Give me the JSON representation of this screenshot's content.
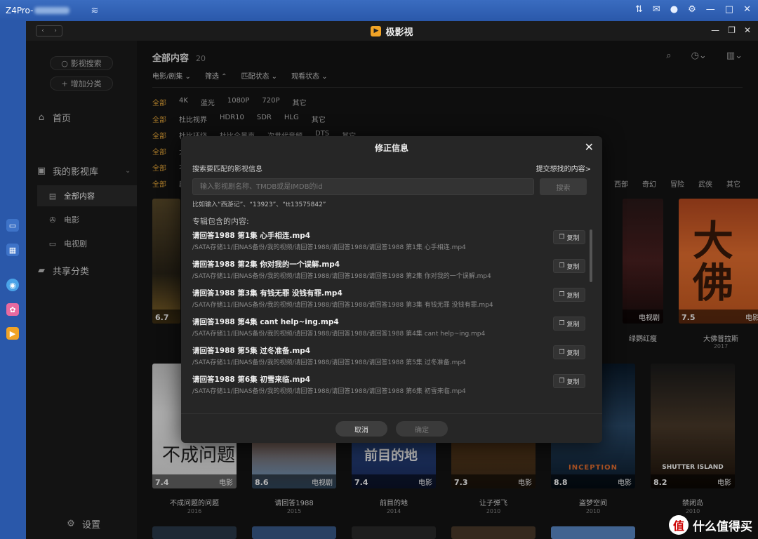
{
  "os": {
    "title": "Z4Pro-",
    "wifi_icon": "wifi-icon"
  },
  "app": {
    "title": "极影视"
  },
  "sidebar": {
    "search_btn": "影视搜索",
    "add_category_btn": "增加分类",
    "home": "首页",
    "my_library": "我的影视库",
    "sub_items": [
      "全部内容",
      "电影",
      "电视剧"
    ],
    "shared": "共享分类",
    "settings": "设置"
  },
  "main": {
    "title": "全部内容",
    "count": "20",
    "dropdowns": [
      "电影/剧集",
      "筛选",
      "匹配状态",
      "观看状态"
    ],
    "filter_rows": [
      [
        "全部",
        "4K",
        "蓝光",
        "1080P",
        "720P",
        "其它"
      ],
      [
        "全部",
        "杜比视界",
        "HDR10",
        "SDR",
        "HLG",
        "其它"
      ],
      [
        "全部",
        "杜比环绕",
        "杜比全景声",
        "次世代音频",
        "DTS",
        "其它"
      ],
      [
        "全部",
        "大"
      ],
      [
        "全部",
        "不"
      ],
      [
        "全部",
        "剧"
      ]
    ],
    "genre_tail": [
      "西部",
      "奇幻",
      "冒险",
      "武侠",
      "其它"
    ]
  },
  "posters_top": [
    {
      "rating": "6.7",
      "type": "",
      "title": "",
      "year": ""
    },
    {
      "rating": "",
      "type": "电视剧",
      "title": "绿鹦红瘦",
      "year": ""
    },
    {
      "rating": "7.5",
      "type": "电影",
      "title": "大佛普拉斯",
      "year": "2017"
    }
  ],
  "posters_bottom": [
    {
      "rating": "7.4",
      "type": "电影",
      "title": "不成问题的问题",
      "year": "2016"
    },
    {
      "rating": "8.6",
      "type": "电视剧",
      "title": "请回答1988",
      "year": "2015"
    },
    {
      "rating": "7.4",
      "type": "电影",
      "title": "前目的地",
      "year": "2014"
    },
    {
      "rating": "7.3",
      "type": "电影",
      "title": "让子弹飞",
      "year": "2010"
    },
    {
      "rating": "8.8",
      "type": "电影",
      "title": "盗梦空间",
      "year": "2010"
    },
    {
      "rating": "8.2",
      "type": "电影",
      "title": "禁闭岛",
      "year": "2010"
    }
  ],
  "poster_art": {
    "p1_text": "前目的地",
    "p2_text": "INCEPTION",
    "p3_text": "SHUTTER ISLAND"
  },
  "modal": {
    "title": "修正信息",
    "label": "搜索要匹配的影视信息",
    "link": "提交想找的内容>",
    "input_placeholder": "输入影视剧名称、TMDB或是IMDB的id",
    "search_btn": "搜索",
    "example": "比如输入“西游记”、“13923”、“tt13575842”",
    "section": "专辑包含的内容:",
    "copy_label": "复制",
    "files": [
      {
        "name": "请回答1988 第1集 心手相连.mp4",
        "path": "/SATA存储11/旧NAS备份/我的视频/请回答1988/请回答1988/请回答1988 第1集 心手相连.mp4"
      },
      {
        "name": "请回答1988 第2集 你对我的一个误解.mp4",
        "path": "/SATA存储11/旧NAS备份/我的视频/请回答1988/请回答1988/请回答1988 第2集 你对我的一个误解.mp4"
      },
      {
        "name": "请回答1988 第3集 有钱无罪 没钱有罪.mp4",
        "path": "/SATA存储11/旧NAS备份/我的视频/请回答1988/请回答1988/请回答1988 第3集 有钱无罪 没钱有罪.mp4"
      },
      {
        "name": "请回答1988 第4集 cant help~ing.mp4",
        "path": "/SATA存储11/旧NAS备份/我的视频/请回答1988/请回答1988/请回答1988 第4集 cant help~ing.mp4"
      },
      {
        "name": "请回答1988 第5集 过冬准备.mp4",
        "path": "/SATA存储11/旧NAS备份/我的视频/请回答1988/请回答1988/请回答1988 第5集 过冬准备.mp4"
      },
      {
        "name": "请回答1988 第6集 初雪来临.mp4",
        "path": "/SATA存储11/旧NAS备份/我的视频/请回答1988/请回答1988/请回答1988 第6集 初雪来临.mp4"
      }
    ],
    "cancel": "取消",
    "ok": "确定"
  },
  "watermark": {
    "text": "什么值得买",
    "badge": "值"
  }
}
